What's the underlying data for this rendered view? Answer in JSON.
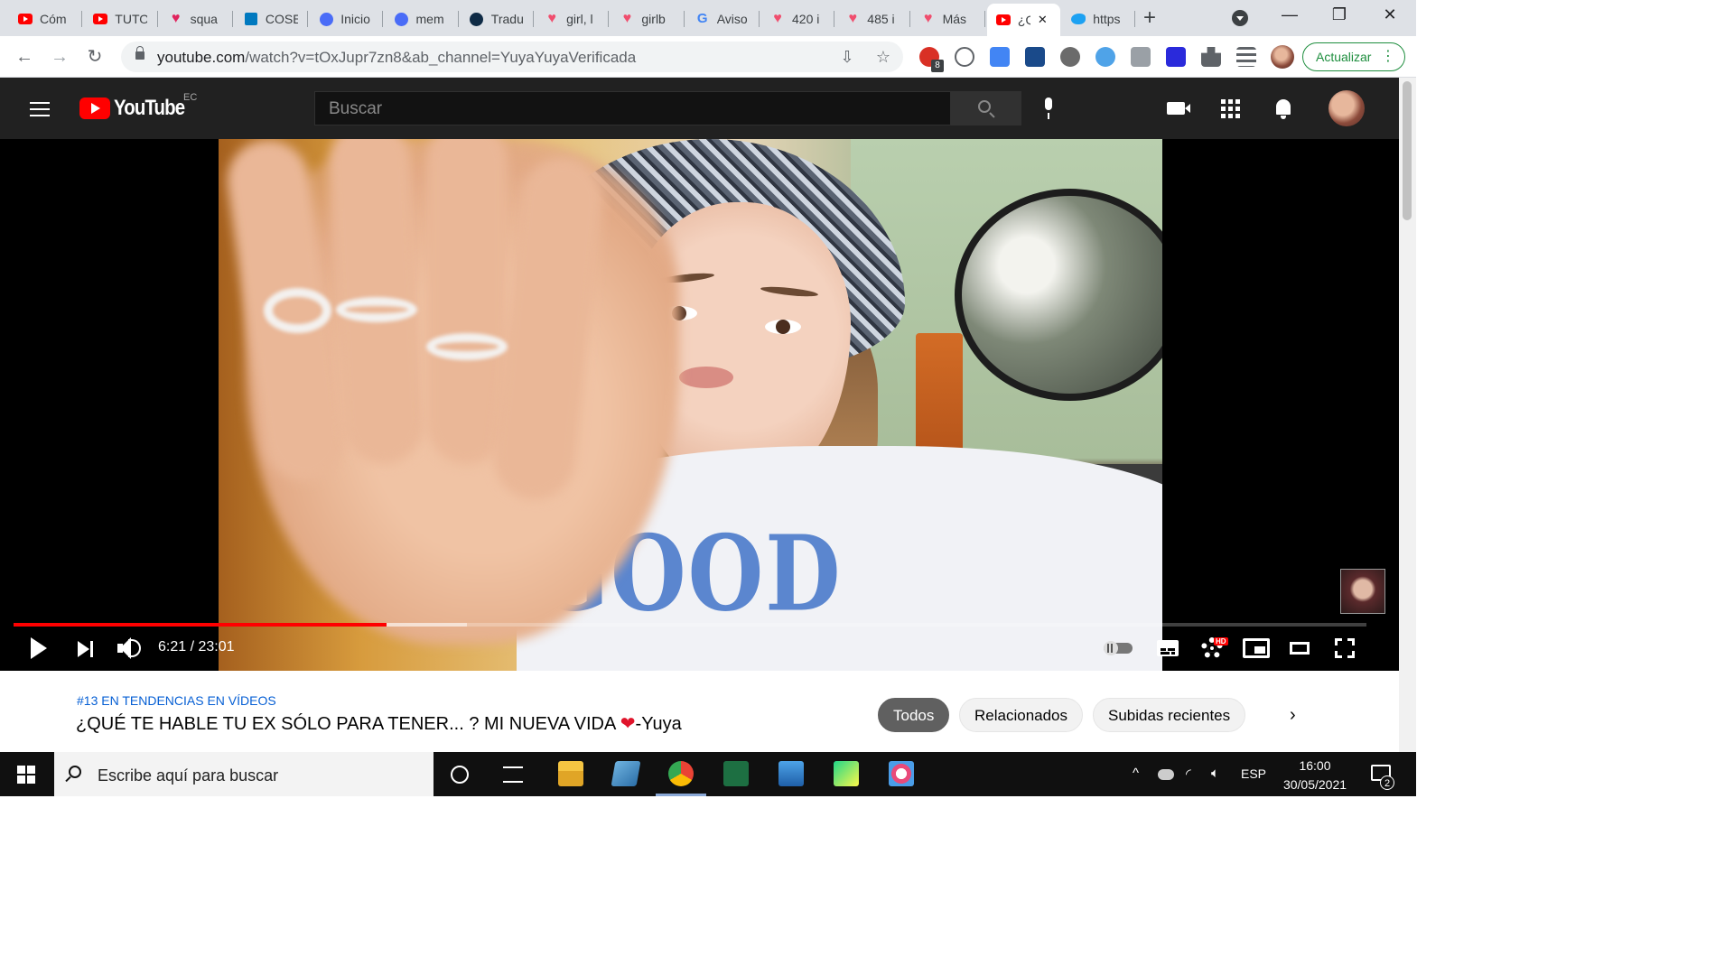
{
  "browser": {
    "tabs": [
      {
        "title": "Cóm",
        "favicon": "youtube-icon",
        "color": "#ff0000"
      },
      {
        "title": "TUTO",
        "favicon": "youtube-icon",
        "color": "#ff0000"
      },
      {
        "title": "squa",
        "favicon": "heart-icon",
        "color": "#e0245e"
      },
      {
        "title": "COSE",
        "favicon": "trello-icon",
        "color": "#0079bf"
      },
      {
        "title": "Inicio",
        "favicon": "canva-icon",
        "color": "#4a6cf7"
      },
      {
        "title": "mem",
        "favicon": "canva-icon",
        "color": "#4a6cf7"
      },
      {
        "title": "Tradu",
        "favicon": "deepl-icon",
        "color": "#0f2b46"
      },
      {
        "title": "girl, l",
        "favicon": "heart-icon",
        "color": "#f04e6e"
      },
      {
        "title": "girlb",
        "favicon": "heart-icon",
        "color": "#f04e6e"
      },
      {
        "title": "Aviso",
        "favicon": "google-icon",
        "color": "#4285f4"
      },
      {
        "title": "420 i",
        "favicon": "heart-icon",
        "color": "#f04e6e"
      },
      {
        "title": "485 i",
        "favicon": "heart-icon",
        "color": "#f04e6e"
      },
      {
        "title": "Más",
        "favicon": "heart-icon",
        "color": "#f04e6e"
      },
      {
        "title": "¿Q",
        "favicon": "youtube-icon",
        "color": "#ff0000",
        "active": true
      },
      {
        "title": "https",
        "favicon": "twitter-icon",
        "color": "#1da1f2"
      }
    ],
    "url_host": "youtube.com",
    "url_path": "/watch?v=tOxJupr7zn8&ab_channel=YuyaYuyaVerificada",
    "update_label": "Actualizar",
    "ext_badge": "8"
  },
  "youtube": {
    "logo_text": "YouTube",
    "country": "EC",
    "search_placeholder": "Buscar"
  },
  "player": {
    "current_time": "6:21",
    "duration": "23:01",
    "time_display": "6:21 / 23:01",
    "progress_fraction": 0.2757,
    "buffered_fraction": 0.335,
    "overlay_text": "GOOD",
    "hd_badge": "HD"
  },
  "video": {
    "trending": "#13 EN TENDENCIAS EN VÍDEOS",
    "title_main": "¿QUÉ TE HABLE TU EX SÓLO PARA TENER... ? MI NUEVA VIDA ",
    "title_heart": "❤",
    "title_suffix": "-Yuya"
  },
  "chips": [
    "Todos",
    "Relacionados",
    "Subidas recientes"
  ],
  "taskbar": {
    "search_placeholder": "Escribe aquí para buscar",
    "language": "ESP",
    "time": "16:00",
    "date": "30/05/2021",
    "notifications": "2"
  }
}
